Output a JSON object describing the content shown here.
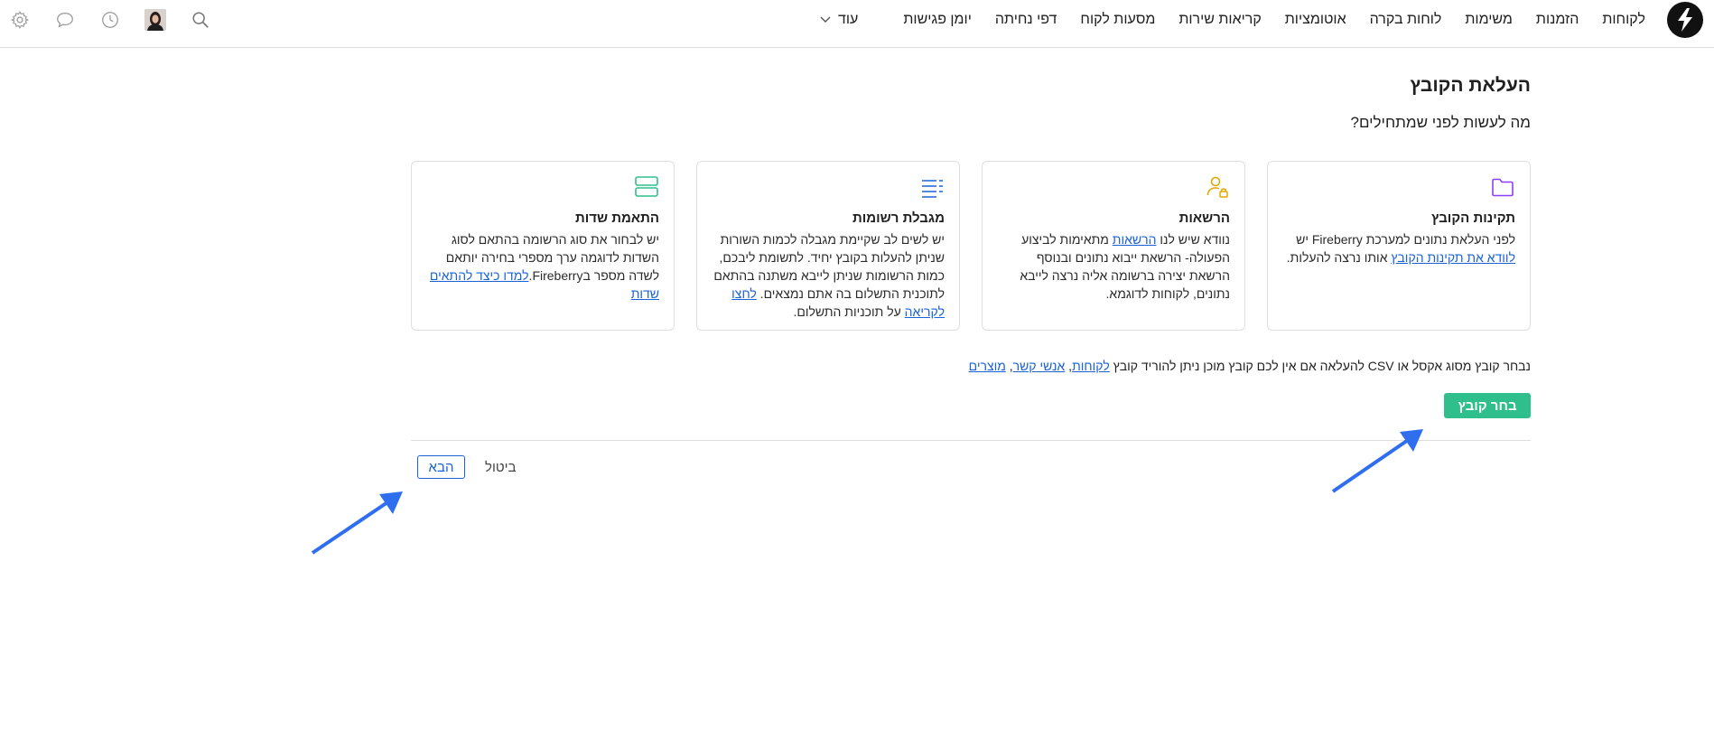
{
  "nav": {
    "items": [
      "לקוחות",
      "הזמנות",
      "משימות",
      "לוחות בקרה",
      "אוטומציות",
      "קריאות שירות",
      "מסעות לקוח",
      "דפי נחיתה",
      "יומן פגישות"
    ],
    "more_label": "עוד"
  },
  "page": {
    "title": "העלאת הקובץ",
    "subtitle": "מה לעשות לפני שמתחילים?"
  },
  "cards": [
    {
      "title": "תקינות הקובץ",
      "icon": "folder-icon",
      "icon_color": "#8a3ffc",
      "text_before": "לפני העלאת נתונים למערכת Fireberry יש ",
      "link": "לוודא את תקינות הקובץ",
      "text_after": " אותו נרצה להעלות."
    },
    {
      "title": "הרשאות",
      "icon": "user-lock-icon",
      "icon_color": "#e0a800",
      "text_before": "נוודא שיש לנו ",
      "link": "הרשאות",
      "text_after": " מתאימות לביצוע הפעולה- הרשאת ייבוא נתונים ובנוסף הרשאת יצירה ברשומה אליה נרצה לייבא נתונים, לקוחות לדוגמא."
    },
    {
      "title": "מגבלת רשומות",
      "icon": "list-icon",
      "icon_color": "#1a62d6",
      "text_before": "יש לשים לב שקיימת מגבלה לכמות השורות שניתן להעלות בקובץ יחיד. לתשומת ליבכם, כמות הרשומות שניתן לייבא משתנה בהתאם לתוכנית התשלום בה אתם נמצאים. ",
      "link": "לחצו לקריאה",
      "text_after": " על תוכניות התשלום."
    },
    {
      "title": "התאמת שדות",
      "icon": "server-icon",
      "icon_color": "#2fbf8c",
      "text_before": "יש לבחור את סוג הרשומה בהתאם לסוג השדות לדוגמה ערך מספרי בחירה יותאם לשדה מספר בFireberry.",
      "link": "למדו כיצד להתאים שדות",
      "text_after": ""
    }
  ],
  "upload": {
    "info_text": "נבחר קובץ מסוג אקסל או CSV להעלאה אם אין לכם קובץ מוכן ניתן להוריד קובץ ",
    "links": [
      "לקוחות",
      "אנשי קשר",
      "מוצרים"
    ],
    "choose_label": "בחר קובץ"
  },
  "footer": {
    "next_label": "הבא",
    "cancel_label": "ביטול"
  },
  "colors": {
    "accent_green": "#2fbf8c",
    "link_blue": "#1a62d6",
    "arrow_blue": "#2f6fef"
  }
}
